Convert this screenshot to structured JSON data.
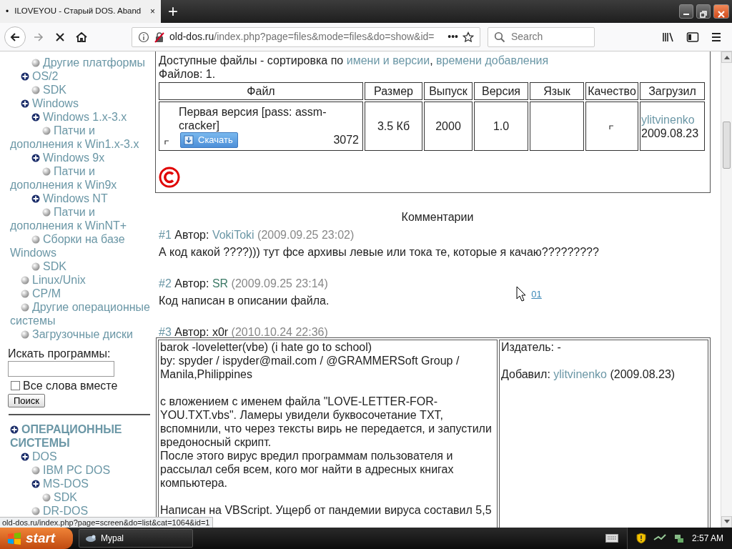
{
  "browser": {
    "tab": {
      "loading_mark": "•",
      "title": "ILOVEYOU - Старый DOS. Aband",
      "selected": true,
      "close": "×"
    },
    "new_tab": "+",
    "url": {
      "domain": "old-dos.ru",
      "path": "/index.php?page=files&mode=files&do=show&id="
    },
    "page_actions": "•••",
    "search": {
      "placeholder": "Search"
    }
  },
  "sidebar": {
    "tree_top": [
      {
        "children": [
          {
            "children": [
              {
                "label": "Другие платформы",
                "kind": "leaf"
              }
            ]
          },
          {
            "label": "OS/2",
            "kind": "branch",
            "children": [
              {
                "label": "SDK",
                "kind": "leaf"
              }
            ]
          },
          {
            "label": "Windows",
            "kind": "branch",
            "children": [
              {
                "label": "Windows 1.x-3.x",
                "kind": "branch",
                "children": [
                  {
                    "label": "Патчи и дополнения к Win1.x-3.x",
                    "kind": "leaf"
                  }
                ]
              },
              {
                "label": "Windows 9x",
                "kind": "branch",
                "children": [
                  {
                    "label": "Патчи и дополнения к Win9x",
                    "kind": "leaf"
                  }
                ]
              },
              {
                "label": "Windows NT",
                "kind": "branch",
                "children": [
                  {
                    "label": "Патчи и дополнения к WinNT+",
                    "kind": "leaf"
                  }
                ]
              },
              {
                "label": "Сборки на базе Windows",
                "kind": "leaf"
              },
              {
                "label": "SDK",
                "kind": "leaf"
              }
            ]
          },
          {
            "label": "Linux/Unix",
            "kind": "leaf"
          },
          {
            "label": "CP/M",
            "kind": "leaf"
          },
          {
            "label": "Другие операционные системы",
            "kind": "leaf"
          },
          {
            "label": "Загрузочные диски",
            "kind": "leaf"
          }
        ]
      }
    ],
    "search": {
      "label": "Искать программы:",
      "checkbox": {
        "label": "Все слова вместе",
        "checked": false
      },
      "button": "Поиск"
    },
    "tree_bottom": [
      {
        "label": "ОПЕРАЦИОННЫЕ СИСТЕМЫ",
        "kind": "branch",
        "children": [
          {
            "label": "DOS",
            "kind": "branch",
            "children": [
              {
                "label": "IBM PC DOS",
                "kind": "leaf"
              },
              {
                "label": "MS-DOS",
                "kind": "branch",
                "children": [
                  {
                    "label": "SDK",
                    "kind": "leaf"
                  }
                ]
              },
              {
                "label": "DR-DOS",
                "kind": "leaf"
              }
            ]
          }
        ]
      }
    ]
  },
  "files": {
    "sort_label": "Доступные файлы - сортировка по",
    "sort_links": [
      "имени и версии",
      "времени добавления"
    ],
    "sort_separator": ",",
    "count": "Файлов: 1.",
    "columns": [
      "Файл",
      "Размер",
      "Выпуск",
      "Версия",
      "Язык",
      "Качество",
      "Загрузил"
    ],
    "rows": [
      {
        "name": "Первая версия [pass: assm-cracker]",
        "download": "Скачать",
        "downloads": "3072",
        "size": "3.5 Кб",
        "release": "2000",
        "version": "1.0",
        "uploader": "ylitvinenko",
        "date": "2009.08.23"
      }
    ]
  },
  "comments": {
    "title": "Комментарии",
    "items": [
      {
        "number": "#1",
        "author_label": "Автор:",
        "author": "VokiToki",
        "author_link": true,
        "visited": false,
        "date": "(2009.09.25 23:02)",
        "text": "А код какой ????))) тут фсе архивы левые или тока те, которые я качаю?????????"
      },
      {
        "number": "#2",
        "author_label": "Автор:",
        "author": "SR",
        "author_link": true,
        "visited": true,
        "date": "(2009.09.25 23:14)",
        "text": "Код написан в описании файла.",
        "extra_link": "01"
      },
      {
        "number": "#3",
        "author_label": "Автор:",
        "author": "x0r",
        "author_link": false,
        "date": "(2010.10.24 22:36)",
        "body": {
          "paragraphs": [
            [
              "barok -loveletter(vbe) (i hate go to school)",
              "by: spyder / ispyder@mail.com / @GRAMMERSoft Group / Manila,Philippines"
            ],
            [
              "с вложением с именем файла \"LOVE-LETTER-FOR-YOU.TXT.vbs\". Ламеры увидели буквосочетание TXT, вспомнили, что через тексты вирь не передается, и запустили вредоносный скрипт.",
              "После этого вирус вредил программам пользователя и рассылал себя всем, кого мог найти в адресных книгах компьютера."
            ],
            [
              "Написан на VBScript. Ущерб от пандемии вируса составил 5,5"
            ]
          ],
          "publisher": "Издатель: -",
          "added_label": "Добавил:",
          "added_by": "ylitvinenko",
          "added_date": "(2009.08.23)"
        }
      }
    ]
  },
  "status_text": "old-dos.ru/index.php?page=screen&do=list&cat=1064&id=1",
  "taskbar": {
    "start": "start",
    "tasks": [
      "Mypal"
    ],
    "clock": "2:57 AM"
  }
}
